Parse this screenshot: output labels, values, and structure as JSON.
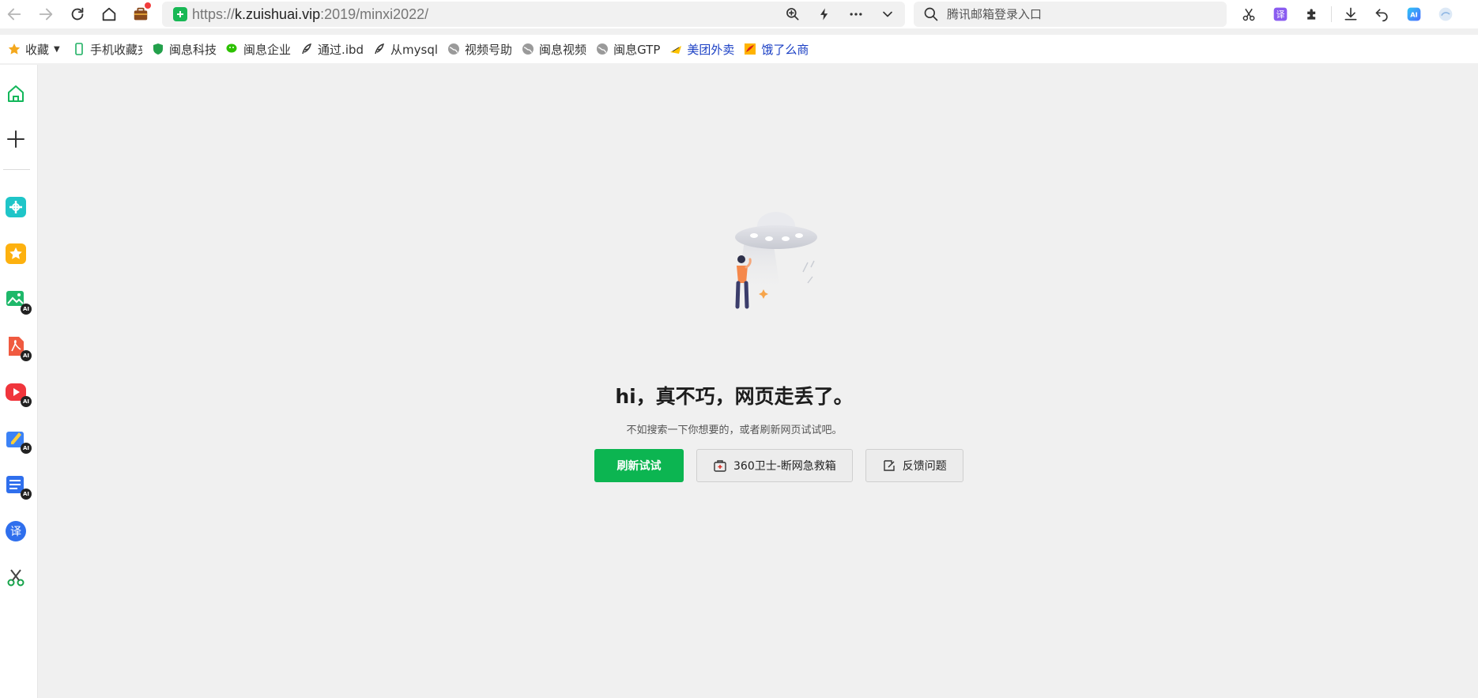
{
  "browser": {
    "url_scheme": "https://",
    "url_host": "k.zuishuai.vip",
    "url_rest": ":2019/minxi2022/",
    "search_placeholder": "腾讯邮箱登录入口",
    "ai_label": "AI"
  },
  "bookmarks": [
    {
      "label": "收藏",
      "icon": "star-icon"
    },
    {
      "label": "手机收藏夹",
      "icon": "phone-icon"
    },
    {
      "label": "闽息科技",
      "icon": "shield-icon"
    },
    {
      "label": "闽息企业",
      "icon": "wechat-icon"
    },
    {
      "label": "通过.ibd",
      "icon": "feather-icon"
    },
    {
      "label": "从mysql",
      "icon": "feather-icon"
    },
    {
      "label": "视频号助",
      "icon": "globe-icon"
    },
    {
      "label": "闽息视频",
      "icon": "globe-icon"
    },
    {
      "label": "闽息GTP",
      "icon": "globe-icon"
    },
    {
      "label": "美团外卖",
      "icon": "meituan-icon"
    },
    {
      "label": "饿了么商",
      "icon": "eleme-icon"
    }
  ],
  "side_rail": {
    "ai_badge": "AI",
    "translate_char": "译"
  },
  "error_page": {
    "title": "hi，真不巧，网页走丢了。",
    "subtitle": "不如搜索一下你想要的，或者刷新网页试试吧。",
    "refresh_button": "刷新试试",
    "rescue_button": "360卫士-断网急救箱",
    "feedback_button": "反馈问题"
  },
  "colors": {
    "primary_green": "#0cb551",
    "background": "#f0f0f0"
  }
}
